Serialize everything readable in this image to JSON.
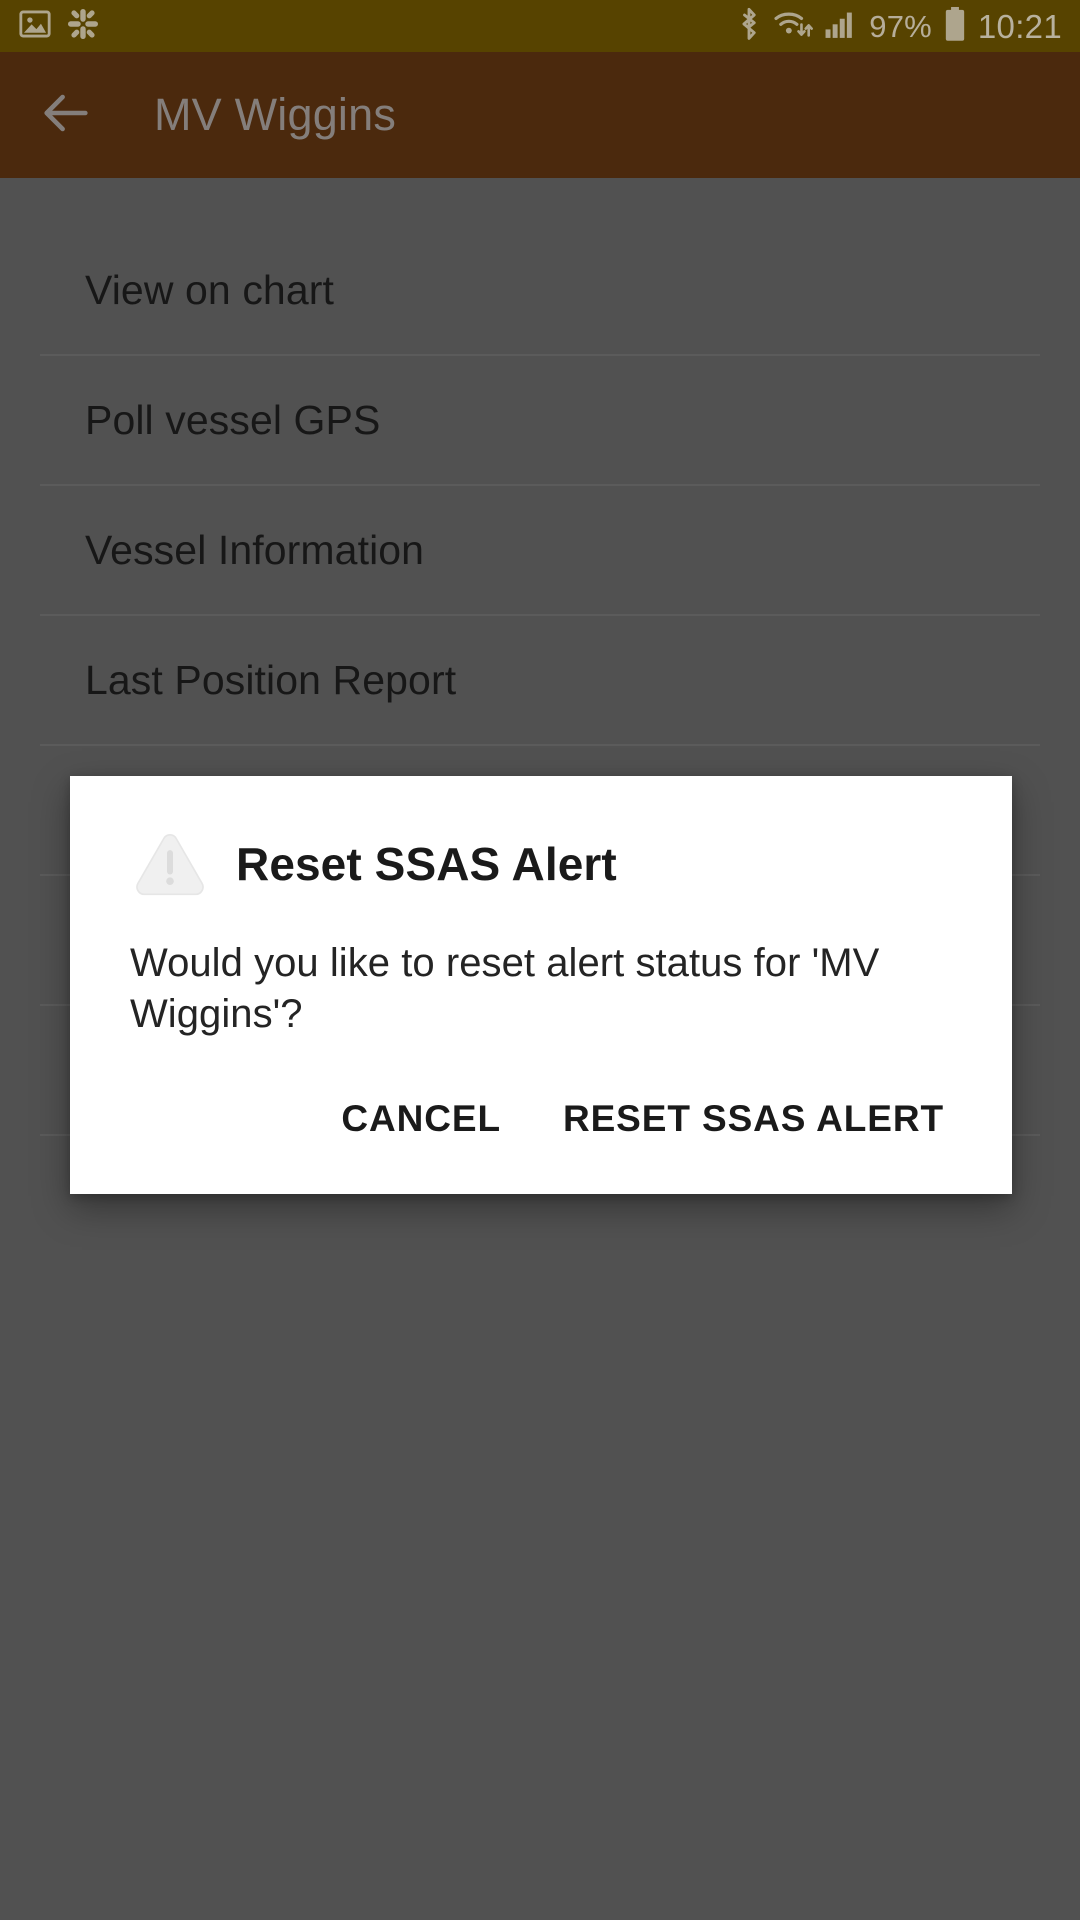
{
  "status_bar": {
    "background": "#6b5200",
    "left_icons": [
      {
        "name": "photo-icon",
        "label": "Gallery"
      },
      {
        "name": "slack-icon",
        "label": "Slack"
      }
    ],
    "right_icons": [
      {
        "name": "bluetooth-icon",
        "label": "Bluetooth"
      },
      {
        "name": "wifi-icon",
        "label": "Wi-Fi"
      },
      {
        "name": "signal-icon",
        "label": "Cellular signal"
      }
    ],
    "battery_percent": "97%",
    "battery_icon": "battery-icon",
    "clock": "10:21"
  },
  "app_bar": {
    "background": "#5c3310",
    "back_icon": "arrow-left-icon",
    "title": "MV Wiggins"
  },
  "list": {
    "items": [
      {
        "label": "View on chart"
      },
      {
        "label": "Poll vessel GPS"
      },
      {
        "label": "Vessel Information"
      },
      {
        "label": "Last Position Report"
      },
      {
        "label": ""
      },
      {
        "label": ""
      },
      {
        "label": ""
      }
    ]
  },
  "dialog": {
    "icon": "warning-triangle-icon",
    "title": "Reset SSAS Alert",
    "message": "Would you like to reset alert status for 'MV Wiggins'?",
    "cancel_label": "CANCEL",
    "confirm_label": "RESET SSAS ALERT",
    "background": "#ffffff"
  },
  "scrim": {
    "color": "#636363"
  }
}
